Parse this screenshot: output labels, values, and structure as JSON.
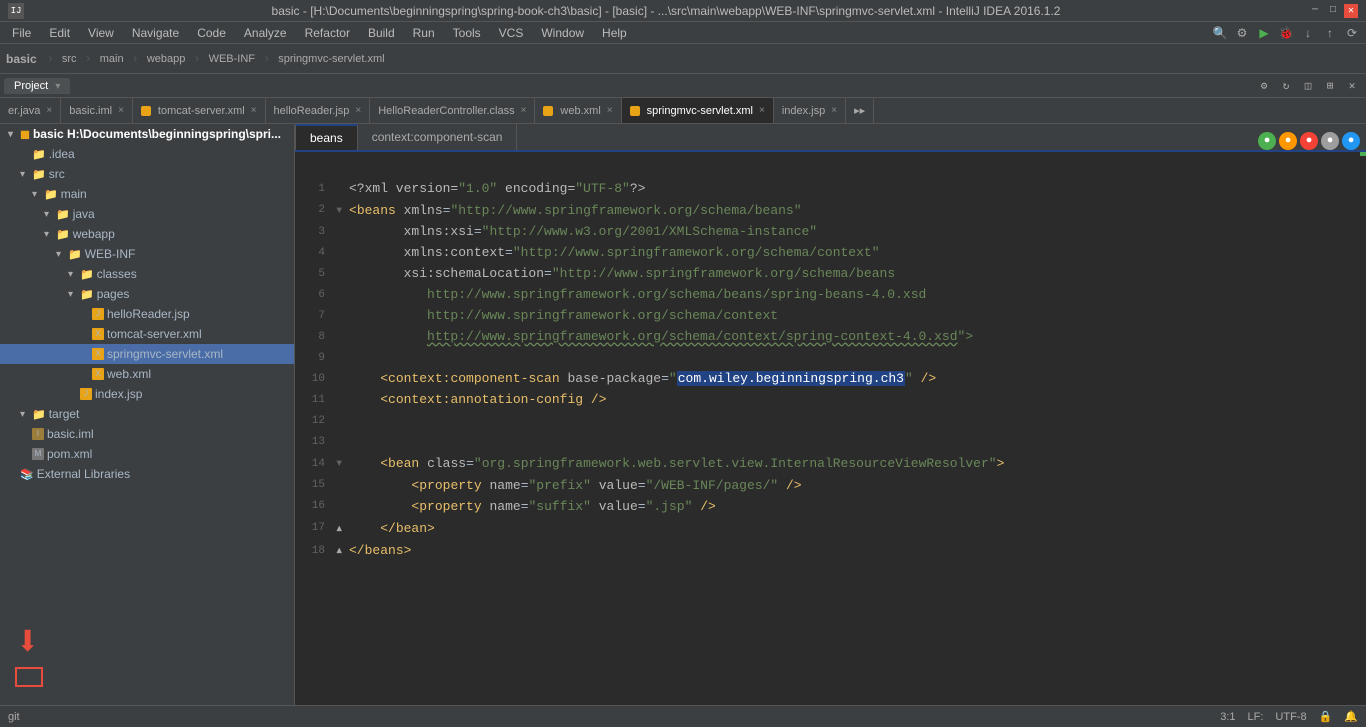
{
  "titlebar": {
    "title": "basic - [H:\\Documents\\beginningspring\\spring-book-ch3\\basic] - [basic] - ...\\src\\main\\webapp\\WEB-INF\\springmvc-servlet.xml - IntelliJ IDEA 2016.1.2",
    "minimize": "─",
    "maximize": "□",
    "close": "✕"
  },
  "menubar": {
    "items": [
      "File",
      "Edit",
      "View",
      "Navigate",
      "Code",
      "Analyze",
      "Refactor",
      "Build",
      "Run",
      "Tools",
      "VCS",
      "Window",
      "Help"
    ]
  },
  "toolbar": {
    "project_label": "basic",
    "breadcrumbs": [
      "src",
      "main",
      "webapp",
      "WEB-INF",
      "springmvc-servlet.xml"
    ]
  },
  "project_panel": {
    "tab_label": "Project",
    "root_node": "basic H:\\Documents\\beginningspring\\spri...",
    "tree": [
      {
        "indent": 0,
        "arrow": "▾",
        "icon": "📁",
        "label": "basic H:\\Documents\\beginningspring\\spri...",
        "type": "root",
        "bold": true
      },
      {
        "indent": 1,
        "arrow": " ",
        "icon": "📁",
        "label": ".idea",
        "type": "folder"
      },
      {
        "indent": 1,
        "arrow": "▾",
        "icon": "📁",
        "label": "src",
        "type": "folder"
      },
      {
        "indent": 2,
        "arrow": "▾",
        "icon": "📁",
        "label": "main",
        "type": "folder"
      },
      {
        "indent": 3,
        "arrow": "▾",
        "icon": "📁",
        "label": "java",
        "type": "folder"
      },
      {
        "indent": 3,
        "arrow": "▾",
        "icon": "📁",
        "label": "webapp",
        "type": "folder"
      },
      {
        "indent": 4,
        "arrow": "▾",
        "icon": "📁",
        "label": "WEB-INF",
        "type": "folder"
      },
      {
        "indent": 5,
        "arrow": "▾",
        "icon": "📁",
        "label": "classes",
        "type": "folder"
      },
      {
        "indent": 5,
        "arrow": "▾",
        "icon": "📁",
        "label": "pages",
        "type": "folder"
      },
      {
        "indent": 6,
        "arrow": " ",
        "icon": "🟧",
        "label": "helloReader.jsp",
        "type": "file"
      },
      {
        "indent": 6,
        "arrow": " ",
        "icon": "🟧",
        "label": "tomcat-server.xml",
        "type": "file"
      },
      {
        "indent": 6,
        "arrow": " ",
        "icon": "🟧",
        "label": "springmvc-servlet.xml",
        "type": "file",
        "selected": true
      },
      {
        "indent": 6,
        "arrow": " ",
        "icon": "🟧",
        "label": "web.xml",
        "type": "file"
      },
      {
        "indent": 4,
        "arrow": " ",
        "icon": "📄",
        "label": "index.jsp",
        "type": "file"
      },
      {
        "indent": 2,
        "arrow": "▾",
        "icon": "📁",
        "label": "target",
        "type": "folder"
      },
      {
        "indent": 2,
        "arrow": " ",
        "icon": "📄",
        "label": "basic.iml",
        "type": "file"
      },
      {
        "indent": 2,
        "arrow": " ",
        "icon": "📄",
        "label": "pom.xml",
        "type": "file"
      },
      {
        "indent": 0,
        "arrow": " ",
        "icon": "📚",
        "label": "External Libraries",
        "type": "lib"
      }
    ]
  },
  "file_tabs": [
    {
      "label": "er.java",
      "active": false,
      "closeable": true
    },
    {
      "label": "basic.iml",
      "active": false,
      "closeable": true
    },
    {
      "label": "tomcat-server.xml",
      "active": false,
      "closeable": true
    },
    {
      "label": "helloReader.jsp",
      "active": false,
      "closeable": true
    },
    {
      "label": "HelloReaderController.class",
      "active": false,
      "closeable": true
    },
    {
      "label": "web.xml",
      "active": false,
      "closeable": true
    },
    {
      "label": "springmvc-servlet.xml",
      "active": true,
      "closeable": true
    },
    {
      "label": "index.jsp",
      "active": false,
      "closeable": true
    },
    {
      "label": "...",
      "active": false,
      "closeable": false
    }
  ],
  "code_tabs": [
    {
      "label": "beans",
      "active": true
    },
    {
      "label": "context:component-scan",
      "active": false
    }
  ],
  "code_content": {
    "lines": [
      {
        "num": "",
        "fold": "",
        "content": ""
      },
      {
        "num": "1",
        "fold": "",
        "content": "<?xml version=\"1.0\" encoding=\"UTF-8\"?>"
      },
      {
        "num": "2",
        "fold": "▾",
        "content": "<beans xmlns=\"http://www.springframework.org/schema/beans\""
      },
      {
        "num": "3",
        "fold": "",
        "content": "       xmlns:xsi=\"http://www.w3.org/2001/XMLSchema-instance\""
      },
      {
        "num": "4",
        "fold": "",
        "content": "       xmlns:context=\"http://www.springframework.org/schema/context\""
      },
      {
        "num": "5",
        "fold": "",
        "content": "       xsi:schemaLocation=\"http://www.springframework.org/schema/beans"
      },
      {
        "num": "6",
        "fold": "",
        "content": "          http://www.springframework.org/schema/beans/spring-beans-4.0.xsd"
      },
      {
        "num": "7",
        "fold": "",
        "content": "          http://www.springframework.org/schema/context"
      },
      {
        "num": "8",
        "fold": "",
        "content": "          http://www.springframework.org/schema/context/spring-context-4.0.xsd\">"
      },
      {
        "num": "9",
        "fold": "",
        "content": ""
      },
      {
        "num": "10",
        "fold": "",
        "content": "    <context:component-scan base-package=\"com.wiley.beginningspring.ch3\" />"
      },
      {
        "num": "11",
        "fold": "",
        "content": "    <context:annotation-config />"
      },
      {
        "num": "12",
        "fold": "",
        "content": ""
      },
      {
        "num": "13",
        "fold": "",
        "content": ""
      },
      {
        "num": "14",
        "fold": "▾",
        "content": "    <bean class=\"org.springframework.web.servlet.view.InternalResourceViewResolver\">"
      },
      {
        "num": "15",
        "fold": "",
        "content": "        <property name=\"prefix\" value=\"/WEB-INF/pages/\" />"
      },
      {
        "num": "16",
        "fold": "",
        "content": "        <property name=\"suffix\" value=\".jsp\" />"
      },
      {
        "num": "17",
        "fold": "▴",
        "content": "    </bean>"
      },
      {
        "num": "18",
        "fold": "▴",
        "content": "</beans>"
      }
    ]
  },
  "status_bar": {
    "position": "3:1",
    "lf_label": "LF:",
    "encoding": "UTF-8",
    "lock_icon": "🔒",
    "git_icon": "git"
  },
  "colors": {
    "bg": "#2b2b2b",
    "sidebar_bg": "#3c3f41",
    "active_tab_bg": "#2b2b2b",
    "accent_blue": "#214283",
    "selected_tree": "#4a6da7",
    "xml_tag": "#e8bf6a",
    "xml_attr": "#bababa",
    "xml_value": "#6a8759",
    "text_main": "#a9b7c6"
  }
}
